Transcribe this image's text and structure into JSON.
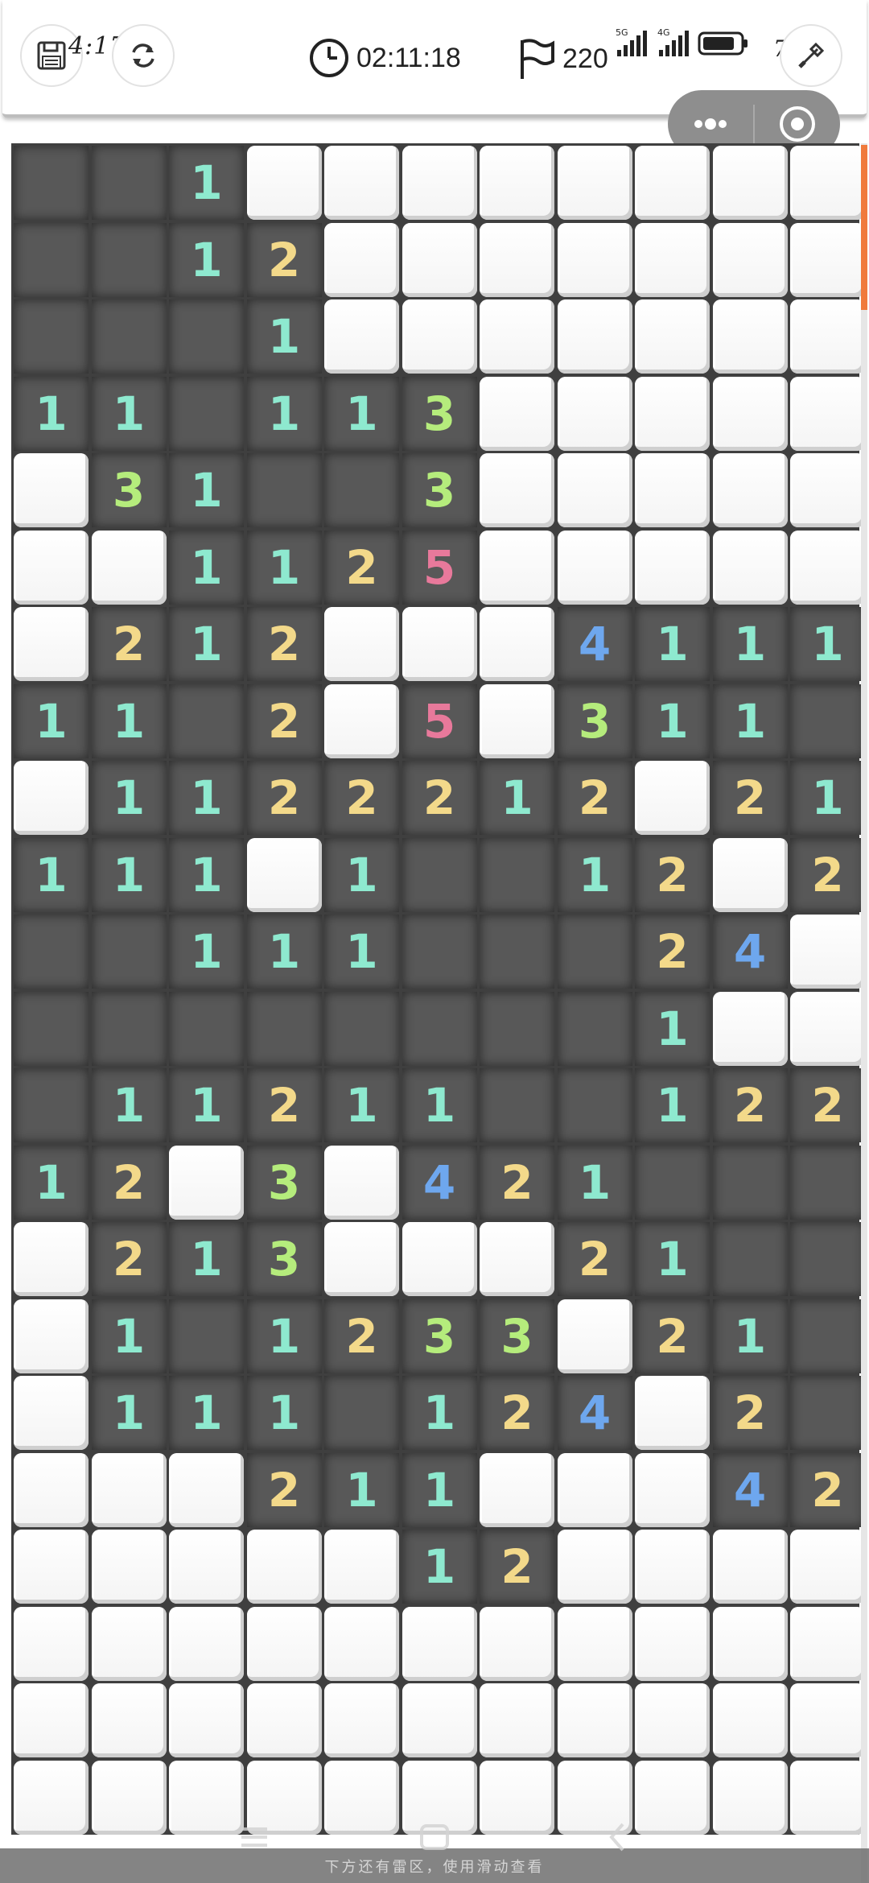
{
  "status_bar": {
    "time": "4:17",
    "battery": "78%",
    "signal_1": "5G",
    "signal_2": "4G"
  },
  "toolbar": {
    "save_icon": "save-icon",
    "restart_icon": "refresh-icon",
    "timer": "02:11:18",
    "flags_remaining": "220",
    "tool_icon": "shovel-icon"
  },
  "capsule": {
    "more_icon": "more-dots-icon",
    "close_icon": "target-icon"
  },
  "colors": {
    "n1": "#8ee9cf",
    "n2": "#f3d98a",
    "n3": "#b5ec7c",
    "n4": "#6ea7ee",
    "n5": "#e8799b",
    "revealed": "#585858",
    "hidden": "#ffffff",
    "scroll_accent": "#f07a3c"
  },
  "board": {
    "columns": 11,
    "legend": "H = hidden tile, 0 = revealed empty, 1-8 = revealed number",
    "rows": [
      [
        "0",
        "0",
        "1",
        "H",
        "H",
        "H",
        "H",
        "H",
        "H",
        "H",
        "H"
      ],
      [
        "0",
        "0",
        "1",
        "2",
        "H",
        "H",
        "H",
        "H",
        "H",
        "H",
        "H"
      ],
      [
        "0",
        "0",
        "0",
        "1",
        "H",
        "H",
        "H",
        "H",
        "H",
        "H",
        "H"
      ],
      [
        "1",
        "1",
        "0",
        "1",
        "1",
        "3",
        "H",
        "H",
        "H",
        "H",
        "H"
      ],
      [
        "H",
        "3",
        "1",
        "0",
        "0",
        "3",
        "H",
        "H",
        "H",
        "H",
        "H"
      ],
      [
        "H",
        "H",
        "1",
        "1",
        "2",
        "5",
        "H",
        "H",
        "H",
        "H",
        "H"
      ],
      [
        "H",
        "2",
        "1",
        "2",
        "H",
        "H",
        "H",
        "4",
        "1",
        "1",
        "1"
      ],
      [
        "1",
        "1",
        "0",
        "2",
        "H",
        "5",
        "H",
        "3",
        "1",
        "1",
        "0"
      ],
      [
        "H",
        "1",
        "1",
        "2",
        "2",
        "2",
        "1",
        "2",
        "H",
        "2",
        "1"
      ],
      [
        "1",
        "1",
        "1",
        "H",
        "1",
        "0",
        "0",
        "1",
        "2",
        "H",
        "2"
      ],
      [
        "0",
        "0",
        "1",
        "1",
        "1",
        "0",
        "0",
        "0",
        "2",
        "4",
        "H"
      ],
      [
        "0",
        "0",
        "0",
        "0",
        "0",
        "0",
        "0",
        "0",
        "1",
        "H",
        "H"
      ],
      [
        "0",
        "1",
        "1",
        "2",
        "1",
        "1",
        "0",
        "0",
        "1",
        "2",
        "2"
      ],
      [
        "1",
        "2",
        "H",
        "3",
        "H",
        "4",
        "2",
        "1",
        "0",
        "0",
        "0"
      ],
      [
        "H",
        "2",
        "1",
        "3",
        "H",
        "H",
        "H",
        "2",
        "1",
        "0",
        "0"
      ],
      [
        "H",
        "1",
        "0",
        "1",
        "2",
        "3",
        "3",
        "H",
        "2",
        "1",
        "0"
      ],
      [
        "H",
        "1",
        "1",
        "1",
        "0",
        "1",
        "2",
        "4",
        "H",
        "2",
        "0"
      ],
      [
        "H",
        "H",
        "H",
        "2",
        "1",
        "1",
        "H",
        "H",
        "H",
        "4",
        "2"
      ],
      [
        "H",
        "H",
        "H",
        "H",
        "H",
        "1",
        "2",
        "H",
        "H",
        "H",
        "H"
      ],
      [
        "H",
        "H",
        "H",
        "H",
        "H",
        "H",
        "H",
        "H",
        "H",
        "H",
        "H"
      ],
      [
        "H",
        "H",
        "H",
        "H",
        "H",
        "H",
        "H",
        "H",
        "H",
        "H",
        "H"
      ],
      [
        "H",
        "H",
        "H",
        "H",
        "H",
        "H",
        "H",
        "H",
        "H",
        "H",
        "H"
      ]
    ]
  },
  "bottom_hint": "下方还有雷区，使用滑动查看"
}
